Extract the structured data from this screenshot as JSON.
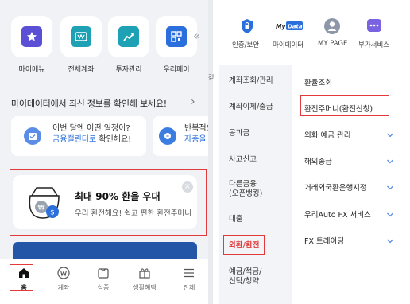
{
  "colors": {
    "accent_blue": "#2a6fdb",
    "red_highlight": "#e03a3a",
    "panel_bg": "#f0f2f6",
    "purple": "#5b4fd6",
    "teal": "#1ea0b5",
    "navy": "#2456a8"
  },
  "left": {
    "quick_menu": [
      {
        "label": "마이메뉴",
        "icon": "star-icon"
      },
      {
        "label": "전체계좌",
        "icon": "wallet-icon"
      },
      {
        "label": "투자관리",
        "icon": "chart-icon"
      },
      {
        "label": "우리페이",
        "icon": "pay-icon"
      }
    ],
    "myinfo_text": "마이데이터에서 최신 정보를 확인해 보세요!",
    "cards": [
      {
        "line1": "이번 달엔 어떤 일정이?",
        "line2_blue": "금융캘린더로",
        "line2_rest": " 확인해요!"
      },
      {
        "line1": "반복적으",
        "line2_blue": "자층을 확",
        "line2_rest": ""
      }
    ],
    "fx_banner": {
      "title": "최대 90% 환율 우대",
      "subtitle": "우리 환전해요! 쉽고 편한 환전주머니",
      "close": "×"
    },
    "tabbar": [
      {
        "label": "홈",
        "icon": "home-icon",
        "active": true
      },
      {
        "label": "계좌",
        "icon": "won-icon",
        "active": false
      },
      {
        "label": "상품",
        "icon": "product-icon",
        "active": false
      },
      {
        "label": "생활혜택",
        "icon": "gift-icon",
        "active": false
      },
      {
        "label": "전체",
        "icon": "menu-icon",
        "active": false
      }
    ],
    "scroll_chevron": "«"
  },
  "right": {
    "side_letter": "긷",
    "top_icons": [
      {
        "label": "인증/보안",
        "icon": "shield-icon"
      },
      {
        "label": "마이데이터",
        "icon": "mydata-icon",
        "badge": "My Data"
      },
      {
        "label": "MY PAGE",
        "icon": "person-icon"
      },
      {
        "label": "부가서비스",
        "icon": "more-icon"
      }
    ],
    "categories": [
      "계좌조회/관리",
      "계좌이체/출금",
      "공과금",
      "사고신고",
      "다른금융\n(오픈뱅킹)",
      "대출",
      "외환/환전",
      "예금/적금/\n신탁/청약"
    ],
    "active_category": "외환/환전",
    "submenu": [
      {
        "label": "환율조회",
        "has_chevron": false
      },
      {
        "label": "환전주머니(환전신청)",
        "has_chevron": false
      },
      {
        "label": "외화 예금 관리",
        "has_chevron": true
      },
      {
        "label": "해외송금",
        "has_chevron": true
      },
      {
        "label": "거래외국환은행지정",
        "has_chevron": true
      },
      {
        "label": "우리Auto FX 서비스",
        "has_chevron": true
      },
      {
        "label": "FX 트레이딩",
        "has_chevron": true
      }
    ]
  }
}
